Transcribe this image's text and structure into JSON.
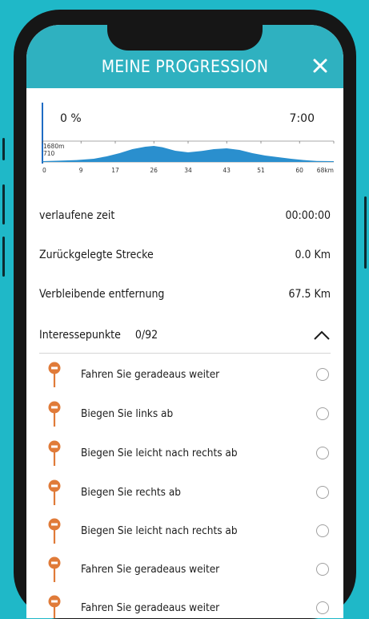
{
  "header": {
    "title": "MEINE PROGRESSION"
  },
  "progress": {
    "percent_label": "0 %",
    "time_label": "7:00"
  },
  "chart_data": {
    "type": "area",
    "elev_top_label": "1680m",
    "elev_bottom_label": "710",
    "xticks": [
      "0",
      "9",
      "17",
      "26",
      "34",
      "43",
      "51",
      "60",
      "68km"
    ],
    "xlim": [
      0,
      68
    ],
    "x": [
      0,
      4,
      8,
      12,
      15,
      18,
      21,
      24,
      26,
      28,
      31,
      34,
      37,
      40,
      43,
      46,
      49,
      52,
      55,
      58,
      61,
      64,
      68
    ],
    "y": [
      0.05,
      0.08,
      0.12,
      0.2,
      0.35,
      0.55,
      0.8,
      0.95,
      1.0,
      0.92,
      0.7,
      0.6,
      0.68,
      0.8,
      0.85,
      0.75,
      0.55,
      0.4,
      0.3,
      0.2,
      0.12,
      0.06,
      0.05
    ],
    "color": "#2a8fce"
  },
  "stats": {
    "elapsed_label": "verlaufene zeit",
    "elapsed_value": "00:00:00",
    "distance_label": "Zurückgelegte Strecke",
    "distance_value": "0.0 Km",
    "remaining_label": "Verbleibende entfernung",
    "remaining_value": "67.5 Km"
  },
  "poi": {
    "header_label": "Interessepunkte",
    "count": "0/92",
    "pin_color": "#e07b39",
    "items": [
      {
        "label": "Fahren Sie geradeaus weiter"
      },
      {
        "label": "Biegen Sie links ab"
      },
      {
        "label": "Biegen Sie leicht nach rechts ab"
      },
      {
        "label": "Biegen Sie rechts ab"
      },
      {
        "label": "Biegen Sie leicht nach rechts ab"
      },
      {
        "label": "Fahren Sie geradeaus weiter"
      },
      {
        "label": "Fahren Sie geradeaus weiter"
      }
    ]
  },
  "colors": {
    "accent": "#2fb1c0",
    "background": "#1fb8c8"
  }
}
